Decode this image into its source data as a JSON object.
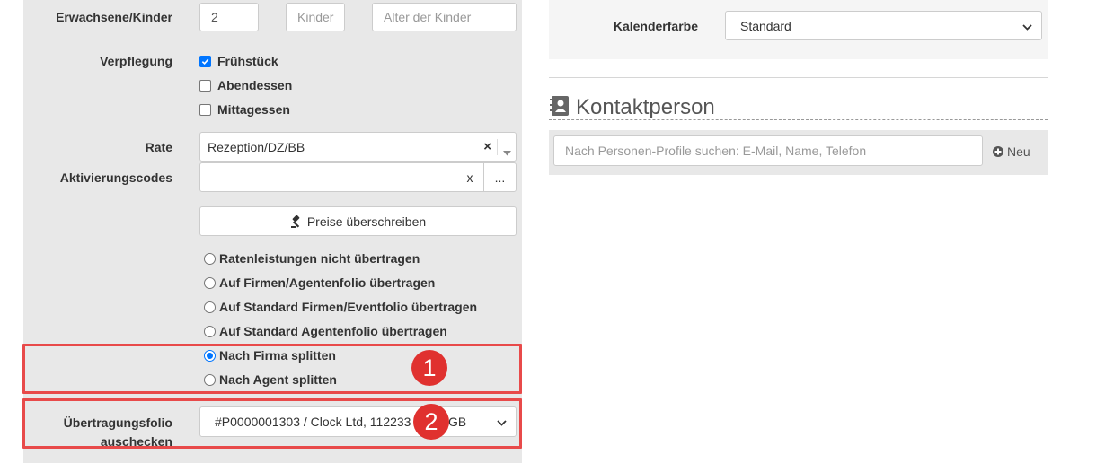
{
  "guests": {
    "label": "Erwachsene/Kinder",
    "adults_value": "2",
    "children_placeholder": "Kinder",
    "ages_placeholder": "Alter der Kinder"
  },
  "meals": {
    "label": "Verpflegung",
    "options": [
      {
        "label": "Frühstück",
        "checked": true
      },
      {
        "label": "Abendessen",
        "checked": false
      },
      {
        "label": "Mittagessen",
        "checked": false
      }
    ]
  },
  "rate": {
    "label": "Rate",
    "value": "Rezeption/DZ/BB",
    "clear_glyph": "×"
  },
  "activation": {
    "label": "Aktivierungscodes",
    "value": "",
    "clear_label": "x",
    "more_label": "..."
  },
  "override_button": {
    "label": "Preise überschreiben",
    "icon": "gavel-icon"
  },
  "transfer_options": [
    {
      "label": "Ratenleistungen nicht übertragen",
      "checked": false
    },
    {
      "label": "Auf Firmen/Agentenfolio übertragen",
      "checked": false
    },
    {
      "label": "Auf Standard Firmen/Eventfolio übertragen",
      "checked": false
    },
    {
      "label": "Auf Standard Agentenfolio übertragen",
      "checked": false
    },
    {
      "label": "Nach Firma splitten",
      "checked": true
    },
    {
      "label": "Nach Agent splitten",
      "checked": false
    }
  ],
  "transfer_folio": {
    "label_line1": "Übertragungsfolio",
    "label_line2": "auschecken",
    "value_left": "#P0000001303 / Clock Ltd, 112233",
    "value_right": "GB"
  },
  "annotations": {
    "badge1": "1",
    "badge2": "2",
    "highlight_color": "#e84a4a",
    "badge_color": "#e0312f"
  },
  "calendar": {
    "label": "Kalenderfarbe",
    "value": "Standard"
  },
  "contact": {
    "title": "Kontaktperson",
    "search_placeholder": "Nach Personen-Profile suchen: E-Mail, Name, Telefon",
    "new_label": "Neu"
  },
  "colors": {
    "checkbox_accent": "#0075ff",
    "panel_bg": "#e8e8e8"
  }
}
